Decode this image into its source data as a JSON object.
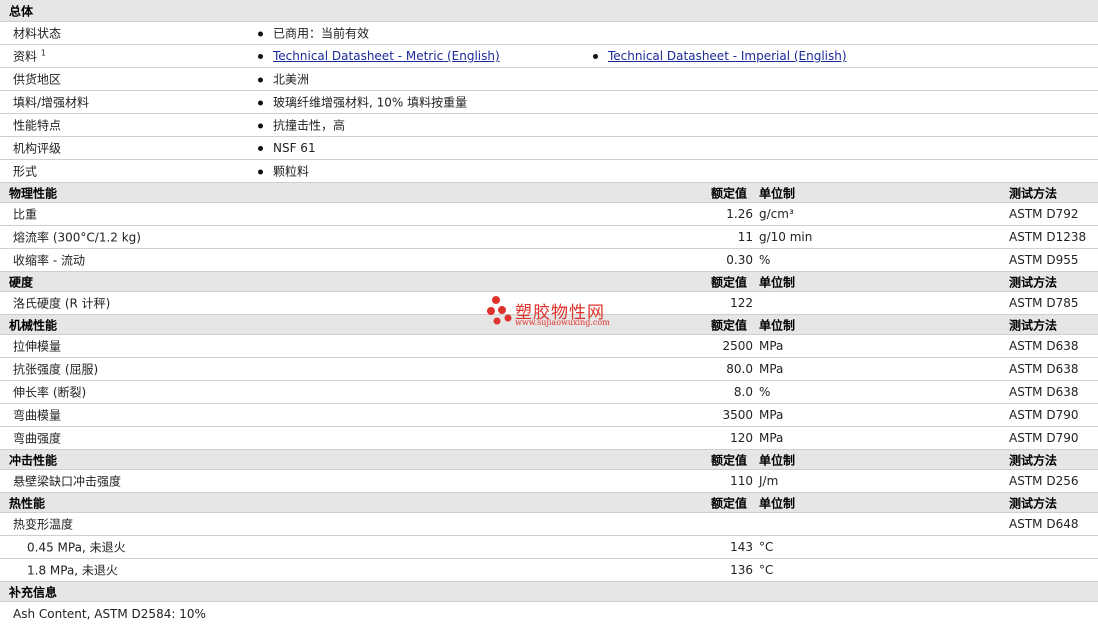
{
  "general": {
    "title": "总体",
    "rows": [
      {
        "label": "材料状态",
        "values": [
          "已商用：当前有效"
        ]
      },
      {
        "label": "资料",
        "sup": "1",
        "links": [
          "Technical Datasheet - Metric (English)",
          "Technical Datasheet - Imperial (English)"
        ]
      },
      {
        "label": "供货地区",
        "values": [
          "北美洲"
        ]
      },
      {
        "label": "填料/增强材料",
        "values": [
          "玻璃纤维增强材料, 10% 填料按重量"
        ]
      },
      {
        "label": "性能特点",
        "values": [
          "抗撞击性，高"
        ]
      },
      {
        "label": "机构评级",
        "values": [
          "NSF 61"
        ]
      },
      {
        "label": "形式",
        "values": [
          "颗粒料"
        ]
      }
    ]
  },
  "col_headers": {
    "value": "额定值",
    "unit": "单位制",
    "method": "测试方法"
  },
  "sections": [
    {
      "title": "物理性能",
      "rows": [
        {
          "label": "比重",
          "value": "1.26",
          "unit": "g/cm³",
          "method": "ASTM D792"
        },
        {
          "label": "熔流率 (300°C/1.2 kg)",
          "value": "11",
          "unit": "g/10 min",
          "method": "ASTM D1238"
        },
        {
          "label": "收缩率 - 流动",
          "value": "0.30",
          "unit": "%",
          "method": "ASTM D955"
        }
      ]
    },
    {
      "title": "硬度",
      "rows": [
        {
          "label": "洛氏硬度 (R 计秤)",
          "value": "122",
          "unit": "",
          "method": "ASTM D785"
        }
      ]
    },
    {
      "title": "机械性能",
      "rows": [
        {
          "label": "拉伸模量",
          "value": "2500",
          "unit": "MPa",
          "method": "ASTM D638"
        },
        {
          "label": "抗张强度 (屈服)",
          "value": "80.0",
          "unit": "MPa",
          "method": "ASTM D638"
        },
        {
          "label": "伸长率 (断裂)",
          "value": "8.0",
          "unit": "%",
          "method": "ASTM D638"
        },
        {
          "label": "弯曲模量",
          "value": "3500",
          "unit": "MPa",
          "method": "ASTM D790"
        },
        {
          "label": "弯曲强度",
          "value": "120",
          "unit": "MPa",
          "method": "ASTM D790"
        }
      ]
    },
    {
      "title": "冲击性能",
      "rows": [
        {
          "label": "悬壁梁缺口冲击强度",
          "value": "110",
          "unit": "J/m",
          "method": "ASTM D256"
        }
      ]
    },
    {
      "title": "热性能",
      "rows": [
        {
          "label": "热变形温度",
          "value": "",
          "unit": "",
          "method": "ASTM D648"
        },
        {
          "label": "0.45 MPa, 未退火",
          "value": "143",
          "unit": "°C",
          "method": "",
          "sub": true
        },
        {
          "label": "1.8 MPa, 未退火",
          "value": "136",
          "unit": "°C",
          "method": "",
          "sub": true
        }
      ]
    }
  ],
  "supplement": {
    "title": "补充信息",
    "text": "Ash Content, ASTM D2584: 10%"
  },
  "watermark": {
    "title": "塑胶物性网",
    "url": "www.sujiaowuxing.com",
    "color": "#e0322c"
  }
}
